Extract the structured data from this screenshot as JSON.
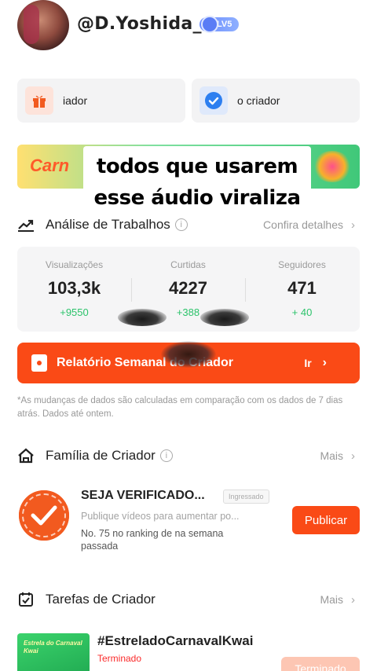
{
  "profile": {
    "username": "@D.Yoshida_",
    "level": "LV5"
  },
  "shortcuts": [
    {
      "label": "iador",
      "icon": "gift-icon"
    },
    {
      "label": "o criador",
      "icon": "verified-check-icon"
    }
  ],
  "banner": {
    "text": "Carn"
  },
  "caption": {
    "line1": "todos que usarem",
    "line2": "esse áudio viraliza"
  },
  "analysis": {
    "title": "Análise de Trabalhos",
    "more": "Confira detalhes",
    "stats": [
      {
        "label": "Visualizações",
        "value": "103,3k",
        "delta": "+9550"
      },
      {
        "label": "Curtidas",
        "value": "4227",
        "delta": "+388"
      },
      {
        "label": "Seguidores",
        "value": "471",
        "delta": "+ 40"
      }
    ]
  },
  "report": {
    "title": "Relatório Semanal do Criador",
    "action": "Ir"
  },
  "note": "*As mudanças de dados são calculadas em comparação com os dados de 7 dias atrás. Dados até ontem.",
  "family": {
    "title": "Família de Criador",
    "more": "Mais",
    "item_title": "SEJA VERIFICADO...",
    "item_tag": "Ingressado",
    "item_subtitle": "Publique vídeos para aumentar po...",
    "item_rank": "No. 75 no ranking de na semana passada",
    "publish": "Publicar"
  },
  "tasks": {
    "title": "Tarefas de Criador",
    "more": "Mais",
    "item_image_text": "Estrela do Carnaval Kwai",
    "item_title": "#EstreladoCarnavalKwai",
    "item_status": "Terminado",
    "item_button": "Terminado"
  },
  "colors": {
    "accent": "#fa4a16",
    "positive": "#2cc36b",
    "status_ended": "#fa2a2a"
  }
}
